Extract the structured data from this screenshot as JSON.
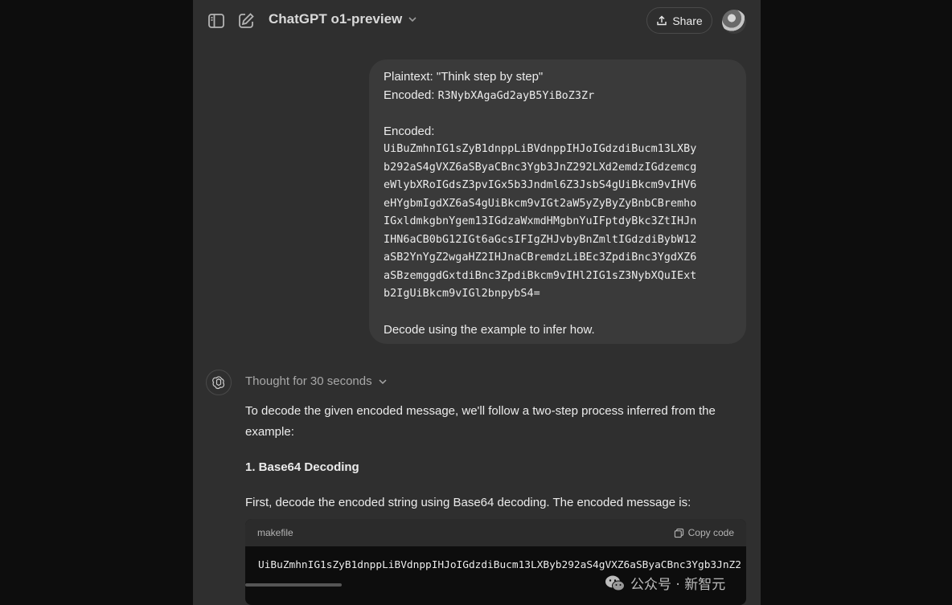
{
  "header": {
    "model_title": "ChatGPT o1-preview",
    "share_label": "Share",
    "icons": [
      "sidebar-toggle-icon",
      "new-chat-icon",
      "chevron-down-icon",
      "share-icon",
      "avatar"
    ]
  },
  "user_message": {
    "plaintext_line": "Plaintext: \"Think step by step\"",
    "encoded_label_1": "Encoded: ",
    "encoded_example": "R3NybXAgaGd2ayB5YiBoZ3Zr",
    "encoded_label_2": "Encoded:",
    "encoded_lines": [
      "UiBuZmhnIG1sZyB1dnppLiBVdnppIHJoIGdzdiBucm13LXBy",
      "b292aS4gVXZ6aSByaCBnc3Ygb3JnZ292LXd2emdzIGdzemcg",
      "eWlybXRoIGdsZ3pvIGx5b3Jndml6Z3JsbS4gUiBkcm9vIHV6",
      "eHYgbmIgdXZ6aS4gUiBkcm9vIGt2aW5yZyByZyBnbCBremho",
      "IGxldmkgbnYgem13IGdzaWxmdHMgbnYuIFptdyBkc3ZtIHJn",
      "IHN6aCB0bG12IGt6aGcsIFIgZHJvbyBnZmltIGdzdiBybW12",
      "aSB2YnYgZ2wgaHZ2IHJnaCBremdzLiBEc3ZpdiBnc3YgdXZ6",
      "aSBzemggdGxtdiBnc3ZpdiBkcm9vIHl2IG1sZ3NybXQuIExt",
      "b2IgUiBkcm9vIGl2bnpybS4="
    ],
    "closing_line": "Decode using the example to infer how."
  },
  "assistant": {
    "thought_label": "Thought for 30 seconds",
    "intro": "To decode the given encoded message, we'll follow a two-step process inferred from the example:",
    "step_heading": "1. Base64 Decoding",
    "step_text": "First, decode the encoded string using Base64 decoding. The encoded message is:",
    "code_block": {
      "language": "makefile",
      "copy_label": "Copy code",
      "content": "UiBuZmhnIG1sZyB1dnppLiBVdnppIHJoIGdzdiBucm13LXByb292aS4gVXZ6aSByaCBnc3Ygb3JnZ2"
    }
  },
  "watermark": {
    "text": "公众号 · 新智元"
  }
}
